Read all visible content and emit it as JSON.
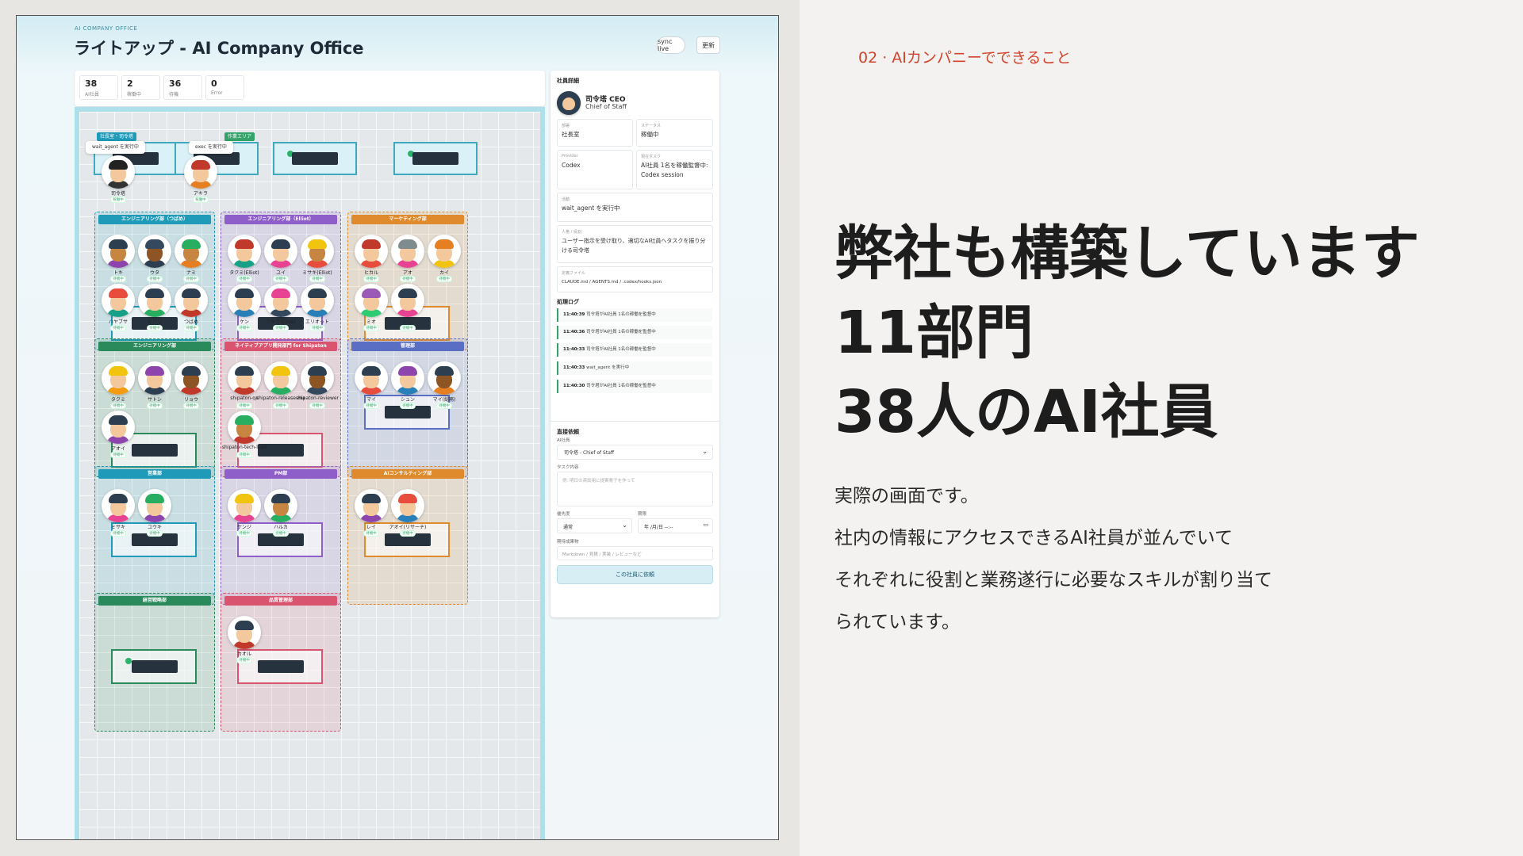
{
  "slide": {
    "eyebrow": "02 · AIカンパニーでできること",
    "headline": [
      "弊社も構築しています",
      "11部門",
      "38人のAI社員"
    ],
    "body": [
      "実際の画面です。",
      "社内の情報にアクセスできるAI社員が並んでいて",
      "それぞれに役割と業務遂行に必要なスキルが割り当て",
      "られています。"
    ]
  },
  "app": {
    "eyebrow": "AI COMPANY OFFICE",
    "title": "ライトアップ - AI Company Office",
    "sync_label": "sync live",
    "refresh_label": "更新",
    "stats": [
      {
        "value": "38",
        "label": "AI社員"
      },
      {
        "value": "2",
        "label": "稼働中"
      },
      {
        "value": "36",
        "label": "待機"
      },
      {
        "value": "0",
        "label": "Error"
      }
    ]
  },
  "floor": {
    "zones": [
      {
        "label": "社長室・司令塔",
        "color": "#1f9ab8"
      },
      {
        "label": "作業エリア",
        "color": "#33a36a"
      }
    ],
    "bubbles": [
      "wait_agent を実行中",
      "exec を実行中"
    ],
    "top_people": [
      {
        "name": "司令塔",
        "status": "稼働中",
        "hair": "#222",
        "body": "#333",
        "skin": "#f2c89c"
      },
      {
        "name": "アキラ",
        "status": "稼働中",
        "hair": "#c0392b",
        "body": "#e67e22",
        "skin": "#f2c89c"
      }
    ],
    "departments": [
      {
        "name": "エンジニアリング部（つばめ）",
        "color": "#1f9ab8",
        "people": [
          {
            "name": "トキ",
            "status": "待機中",
            "hair": "#2c3e50",
            "body": "#8e44ad",
            "skin": "#c68642"
          },
          {
            "name": "ウタ",
            "status": "待機中",
            "hair": "#34495e",
            "body": "#2c3e50",
            "skin": "#8d5524"
          },
          {
            "name": "ナミ",
            "status": "待機中",
            "hair": "#27ae60",
            "body": "#e67e22",
            "skin": "#c68642"
          },
          {
            "name": "ハヤブサ",
            "status": "待機中",
            "hair": "#e74c3c",
            "body": "#16a085",
            "skin": "#f2c89c"
          },
          {
            "name": "ヒバリ",
            "status": "待機中",
            "hair": "#2c3e50",
            "body": "#27ae60",
            "skin": "#f2c89c"
          },
          {
            "name": "つばめ",
            "status": "待機中",
            "hair": "#2c3e50",
            "body": "#c0392b",
            "skin": "#f2c89c"
          }
        ]
      },
      {
        "name": "エンジニアリング部（Elliot）",
        "color": "#8e5fc8",
        "people": [
          {
            "name": "タクミ(Elliot)",
            "status": "待機中",
            "hair": "#c0392b",
            "body": "#16a085",
            "skin": "#f2c89c"
          },
          {
            "name": "ユイ",
            "status": "待機中",
            "hair": "#2c3e50",
            "body": "#e84393",
            "skin": "#f2c89c"
          },
          {
            "name": "ミサキ(Elliot)",
            "status": "待機中",
            "hair": "#f1c40f",
            "body": "#e74c3c",
            "skin": "#c68642"
          },
          {
            "name": "ケン",
            "status": "待機中",
            "hair": "#2c3e50",
            "body": "#2980b9",
            "skin": "#f2c89c"
          },
          {
            "name": "アキラ(Elliot)",
            "status": "待機中",
            "hair": "#e84393",
            "body": "#34495e",
            "skin": "#f2c89c"
          },
          {
            "name": "エリオット",
            "status": "待機中",
            "hair": "#2c3e50",
            "body": "#2980b9",
            "skin": "#f2c89c"
          }
        ]
      },
      {
        "name": "マーケティング部",
        "color": "#e08a2e",
        "people": [
          {
            "name": "ヒカル",
            "status": "待機中",
            "hair": "#c0392b",
            "body": "#e74c3c",
            "skin": "#f2c89c"
          },
          {
            "name": "アオ",
            "status": "待機中",
            "hair": "#7f8c8d",
            "body": "#e84393",
            "skin": "#f2c89c"
          },
          {
            "name": "カイ",
            "status": "待機中",
            "hair": "#e67e22",
            "body": "#f1c40f",
            "skin": "#f2c89c"
          },
          {
            "name": "ミオ",
            "status": "待機中",
            "hair": "#9b59b6",
            "body": "#2ecc71",
            "skin": "#f2c89c"
          },
          {
            "name": "レン",
            "status": "待機中",
            "hair": "#2c3e50",
            "body": "#e84393",
            "skin": "#f2c89c"
          }
        ]
      },
      {
        "name": "エンジニアリング部",
        "color": "#2a8a5c",
        "people": [
          {
            "name": "タクミ",
            "status": "待機中",
            "hair": "#f1c40f",
            "body": "#f39c12",
            "skin": "#f2c89c"
          },
          {
            "name": "サトシ",
            "status": "待機中",
            "hair": "#8e44ad",
            "body": "#2c3e50",
            "skin": "#f2c89c"
          },
          {
            "name": "リョウ",
            "status": "待機中",
            "hair": "#2c3e50",
            "body": "#c0392b",
            "skin": "#8d5524"
          },
          {
            "name": "アオイ",
            "status": "待機中",
            "hair": "#2c3e50",
            "body": "#8e44ad",
            "skin": "#f2c89c"
          }
        ]
      },
      {
        "name": "ネイティブアプリ開発部門 for Shipaton",
        "color": "#d9546e",
        "people": [
          {
            "name": "shipaton-qa",
            "status": "待機中",
            "hair": "#2c3e50",
            "body": "#c0392b",
            "skin": "#f2c89c"
          },
          {
            "name": "shipaton-release-manager",
            "status": "待機中",
            "hair": "#f1c40f",
            "body": "#27ae60",
            "skin": "#f2c89c"
          },
          {
            "name": "shipaton-reviewer",
            "status": "待機中",
            "hair": "#2c3e50",
            "body": "#34495e",
            "skin": "#8d5524"
          },
          {
            "name": "shipaton-tech-lead",
            "status": "待機中",
            "hair": "#27ae60",
            "body": "#c0392b",
            "skin": "#c68642"
          }
        ]
      },
      {
        "name": "管理部",
        "color": "#5a6fc4",
        "people": [
          {
            "name": "マイ",
            "status": "待機中",
            "hair": "#2c3e50",
            "body": "#e74c3c",
            "skin": "#f2c89c"
          },
          {
            "name": "シュン",
            "status": "待機中",
            "hair": "#8e44ad",
            "body": "#2980b9",
            "skin": "#f2c89c"
          },
          {
            "name": "マイ(総務)",
            "status": "待機中",
            "hair": "#2c3e50",
            "body": "#e67e22",
            "skin": "#8d5524"
          }
        ]
      },
      {
        "name": "営業部",
        "color": "#1f9ab8",
        "people": [
          {
            "name": "ミサキ",
            "status": "待機中",
            "hair": "#2c3e50",
            "body": "#e84393",
            "skin": "#f2c89c"
          },
          {
            "name": "ユウキ",
            "status": "待機中",
            "hair": "#27ae60",
            "body": "#8e44ad",
            "skin": "#f2c89c"
          }
        ]
      },
      {
        "name": "PM部",
        "color": "#8e5fc8",
        "people": [
          {
            "name": "ケンジ",
            "status": "待機中",
            "hair": "#f1c40f",
            "body": "#e84393",
            "skin": "#f2c89c"
          },
          {
            "name": "ハルカ",
            "status": "待機中",
            "hair": "#2c3e50",
            "body": "#27ae60",
            "skin": "#c68642"
          }
        ]
      },
      {
        "name": "AIコンサルティング部",
        "color": "#e08a2e",
        "people": [
          {
            "name": "レイ",
            "status": "待機中",
            "hair": "#2c3e50",
            "body": "#8e44ad",
            "skin": "#f2c89c"
          },
          {
            "name": "アオイ(リサーチ)",
            "status": "待機中",
            "hair": "#e74c3c",
            "body": "#2980b9",
            "skin": "#f2c89c"
          }
        ]
      },
      {
        "name": "経営戦略部",
        "color": "#2a8a5c",
        "people": []
      },
      {
        "name": "品質管理部",
        "color": "#d9546e",
        "people": [
          {
            "name": "カオル",
            "status": "待機中",
            "hair": "#2c3e50",
            "body": "#c0392b",
            "skin": "#f2c89c"
          }
        ]
      }
    ]
  },
  "detail": {
    "section_title": "社員詳細",
    "name": "司令塔 CEO",
    "role": "Chief of Staff",
    "fields": [
      {
        "label": "部署",
        "value": "社長室"
      },
      {
        "label": "ステータス",
        "value": "稼働中"
      },
      {
        "label": "Provider",
        "value": "Codex"
      },
      {
        "label": "現在タスク",
        "value": "AI社員 1名を稼働監督中: Codex session"
      }
    ],
    "activity": {
      "label": "活動",
      "value": "wait_agent を実行中"
    },
    "role_box": {
      "label": "人格 / 役割",
      "value": "ユーザー指示を受け取り、適切なAI社員へタスクを振り分ける司令塔"
    },
    "files": {
      "label": "定義ファイル",
      "value": "CLAUDE.md / AGENTS.md / .codex/hooks.json"
    },
    "log_title": "処理ログ",
    "logs": [
      {
        "time": "11:40:39",
        "text": "司令塔がAI社員 1名の稼働を監督中"
      },
      {
        "time": "11:40:36",
        "text": "司令塔がAI社員 1名の稼働を監督中"
      },
      {
        "time": "11:40:33",
        "text": "司令塔がAI社員 1名の稼働を監督中"
      },
      {
        "time": "11:40:33",
        "text": "wait_agent を実行中"
      },
      {
        "time": "11:40:30",
        "text": "司令塔がAI社員 1名の稼働を監督中"
      }
    ],
    "request": {
      "title": "直接依頼",
      "employee_label": "AI社員",
      "employee_value": "司令塔 - Chief of Staff",
      "task_label": "タスク内容",
      "task_placeholder": "例: 明日の商談用に提案骨子を作って",
      "priority_label": "優先度",
      "priority_value": "通常",
      "deadline_label": "期限",
      "deadline_value": "年 /月/日 --:--",
      "deliverable_label": "期待成果物",
      "deliverable_placeholder": "Markdown / 見積 / 実装 / レビューなど",
      "submit_label": "この社員に依頼"
    }
  }
}
